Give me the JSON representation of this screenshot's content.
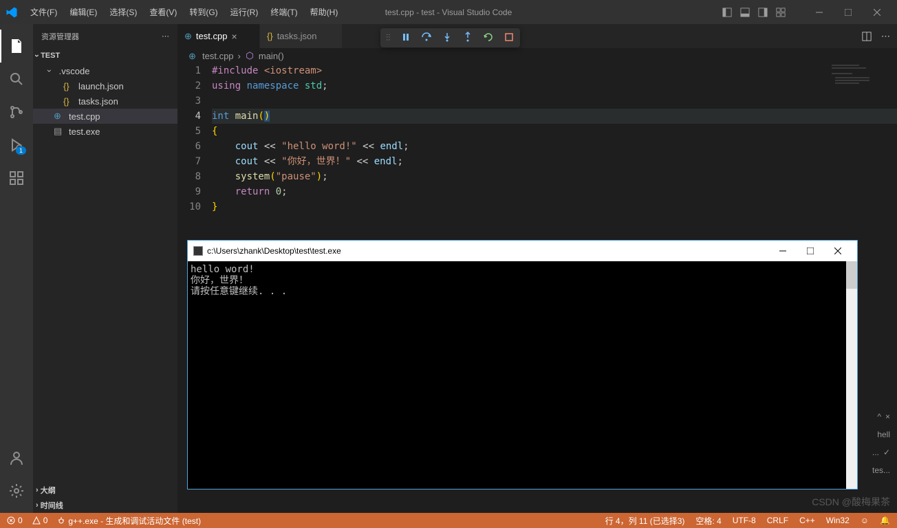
{
  "title": "test.cpp - test - Visual Studio Code",
  "menu": [
    "文件(F)",
    "编辑(E)",
    "选择(S)",
    "查看(V)",
    "转到(G)",
    "运行(R)",
    "终端(T)",
    "帮助(H)"
  ],
  "activity_badge": "1",
  "sidebar": {
    "title": "资源管理器",
    "root": "TEST",
    "folder1": ".vscode",
    "files": [
      "launch.json",
      "tasks.json",
      "test.cpp",
      "test.exe"
    ],
    "outline": "大纲",
    "timeline": "时间线"
  },
  "tabs": [
    {
      "label": "test.cpp",
      "active": true
    },
    {
      "label": "tasks.json",
      "active": false
    }
  ],
  "breadcrumb": {
    "file": "test.cpp",
    "symbol": "main()"
  },
  "code": {
    "lines": [
      "1",
      "2",
      "3",
      "4",
      "5",
      "6",
      "7",
      "8",
      "9",
      "10"
    ],
    "l1_a": "#include",
    "l1_b": " <iostream>",
    "l2_a": "using",
    "l2_b": " namespace",
    "l2_c": " std",
    "l2_d": ";",
    "l4_a": "int",
    "l4_b": " main",
    "l4_c": "(",
    "l4_d": ")",
    "l5": "{",
    "l6_a": "    cout ",
    "l6_b": "<<",
    "l6_c": " \"hello word!\"",
    "l6_d": " << ",
    "l6_e": "endl",
    "l6_f": ";",
    "l7_a": "    cout ",
    "l7_b": "<<",
    "l7_c": " \"你好，世界！\"",
    "l7_d": " << ",
    "l7_e": "endl",
    "l7_f": ";",
    "l8_a": "    ",
    "l8_b": "system",
    "l8_c": "(",
    "l8_d": "\"pause\"",
    "l8_e": ")",
    "l8_f": ";",
    "l9_a": "    ",
    "l9_b": "return",
    "l9_c": " 0",
    "l9_d": ";",
    "l10": "}"
  },
  "console": {
    "title": "c:\\Users\\zhank\\Desktop\\test\\test.exe",
    "line1": "hello word!",
    "line2": "你好，世界！",
    "line3": "请按任意键继续. . ."
  },
  "panel": {
    "shell": "hell",
    "dots": "...",
    "task": "tes..."
  },
  "status": {
    "errors": "0",
    "warnings": "0",
    "debug": "g++.exe - 生成和调试活动文件 (test)",
    "pos": "行 4，列 11 (已选择3)",
    "spaces": "空格: 4",
    "enc": "UTF-8",
    "eol": "CRLF",
    "lang": "C++",
    "arch": "Win32"
  },
  "watermark": "CSDN @酸梅果茶"
}
